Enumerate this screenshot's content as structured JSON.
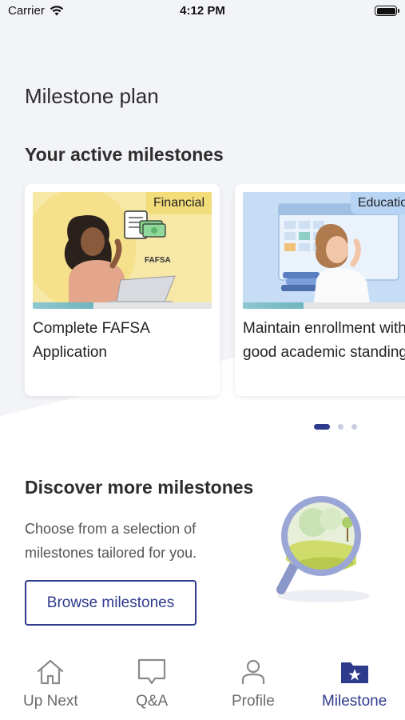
{
  "status_bar": {
    "carrier": "Carrier",
    "time": "4:12 PM"
  },
  "page_title": "Milestone plan",
  "active_section_title": "Your active milestones",
  "milestones": [
    {
      "tag": "Financial",
      "title": "Complete FAFSA Application",
      "progress": 0.34,
      "tag_color": "#f3dc7a",
      "art_bg": "#f7e8a8",
      "art_text": "FAFSA"
    },
    {
      "tag": "Education",
      "title": "Maintain enrollment with good academic standing",
      "progress": 0.34,
      "tag_color": "#b7d4f4",
      "art_bg": "#c6ddf5"
    }
  ],
  "carousel_dots": {
    "count": 3,
    "active_index": 0
  },
  "discover": {
    "title": "Discover more milestones",
    "description": "Choose from a selection of milestones tailored for you.",
    "button_label": "Browse milestones"
  },
  "tabs": [
    {
      "label": "Up Next",
      "icon": "home-icon",
      "active": false
    },
    {
      "label": "Q&A",
      "icon": "chat-bubble-icon",
      "active": false
    },
    {
      "label": "Profile",
      "icon": "person-icon",
      "active": false
    },
    {
      "label": "Milestone",
      "icon": "star-folder-icon",
      "active": true
    }
  ],
  "colors": {
    "accent": "#2e3a8c",
    "background": "#f3f4f8",
    "tab_inactive": "#6b6b6b"
  }
}
